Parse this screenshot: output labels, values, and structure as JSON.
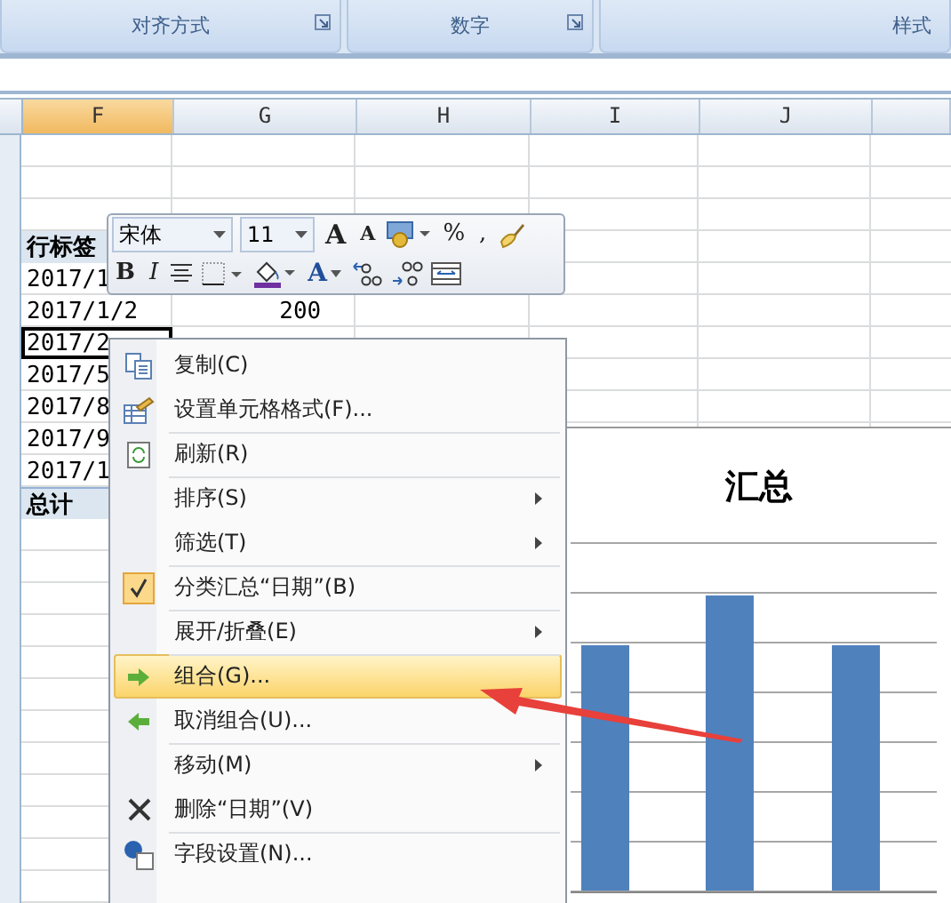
{
  "ribbon_groups": [
    {
      "label": "对齐方式",
      "launcher": true
    },
    {
      "label": "数字",
      "launcher": true
    },
    {
      "label": "样式",
      "launcher": false
    }
  ],
  "columns": [
    {
      "label": "F",
      "selected": true
    },
    {
      "label": "G",
      "selected": false
    },
    {
      "label": "H",
      "selected": false
    },
    {
      "label": "I",
      "selected": false
    },
    {
      "label": "J",
      "selected": false
    }
  ],
  "rows": [
    {
      "kind": "header",
      "label": "行标签",
      "value": "",
      "selected": false
    },
    {
      "kind": "item",
      "label": "2017/1",
      "value": "",
      "selected": false
    },
    {
      "kind": "item",
      "label": "2017/1/2",
      "value": "200",
      "selected": false
    },
    {
      "kind": "item",
      "label": "2017/2",
      "value": "",
      "selected": true
    },
    {
      "kind": "item",
      "label": "2017/5",
      "value": "",
      "selected": false
    },
    {
      "kind": "item",
      "label": "2017/8",
      "value": "",
      "selected": false
    },
    {
      "kind": "item",
      "label": "2017/9",
      "value": "",
      "selected": false
    },
    {
      "kind": "item",
      "label": "2017/1",
      "value": "",
      "selected": false
    },
    {
      "kind": "total",
      "label": "总计",
      "value": "",
      "selected": false
    }
  ],
  "mini_toolbar": {
    "font": "宋体",
    "size": "11",
    "row1": [
      {
        "kind": "grow",
        "label": "A"
      },
      {
        "kind": "shrink",
        "label": "A"
      },
      {
        "kind": "currency"
      },
      {
        "kind": "text",
        "label": "%"
      },
      {
        "kind": "text",
        "label": ","
      },
      {
        "kind": "painter"
      }
    ],
    "row2": [
      {
        "kind": "bold",
        "label": "B"
      },
      {
        "kind": "italic",
        "label": "I"
      },
      {
        "kind": "center"
      },
      {
        "kind": "borders"
      },
      {
        "kind": "fill"
      },
      {
        "kind": "fontcolor",
        "label": "A"
      },
      {
        "kind": "incdec"
      },
      {
        "kind": "decdec"
      },
      {
        "kind": "merge"
      }
    ]
  },
  "context_menu": [
    {
      "label": "复制(C)",
      "submenu": false,
      "checked": false,
      "selected": false,
      "separator": false
    },
    {
      "label": "设置单元格格式(F)...",
      "submenu": false,
      "checked": false,
      "selected": false,
      "separator": false
    },
    {
      "label": "刷新(R)",
      "submenu": false,
      "checked": false,
      "selected": false,
      "separator": true
    },
    {
      "label": "排序(S)",
      "submenu": true,
      "checked": false,
      "selected": false,
      "separator": true
    },
    {
      "label": "筛选(T)",
      "submenu": true,
      "checked": false,
      "selected": false,
      "separator": false
    },
    {
      "label": "分类汇总“日期”(B)",
      "submenu": false,
      "checked": true,
      "selected": false,
      "separator": true
    },
    {
      "label": "展开/折叠(E)",
      "submenu": true,
      "checked": false,
      "selected": false,
      "separator": true
    },
    {
      "label": "组合(G)...",
      "submenu": false,
      "checked": false,
      "selected": true,
      "separator": true
    },
    {
      "label": "取消组合(U)...",
      "submenu": false,
      "checked": false,
      "selected": false,
      "separator": false
    },
    {
      "label": "移动(M)",
      "submenu": true,
      "checked": false,
      "selected": false,
      "separator": true
    },
    {
      "label": "删除“日期”(V)",
      "submenu": false,
      "checked": false,
      "selected": false,
      "separator": false
    },
    {
      "label": "字段设置(N)...",
      "submenu": false,
      "checked": false,
      "selected": false,
      "separator": true
    }
  ],
  "chart": {
    "title": "汇总",
    "kind": "picture"
  }
}
